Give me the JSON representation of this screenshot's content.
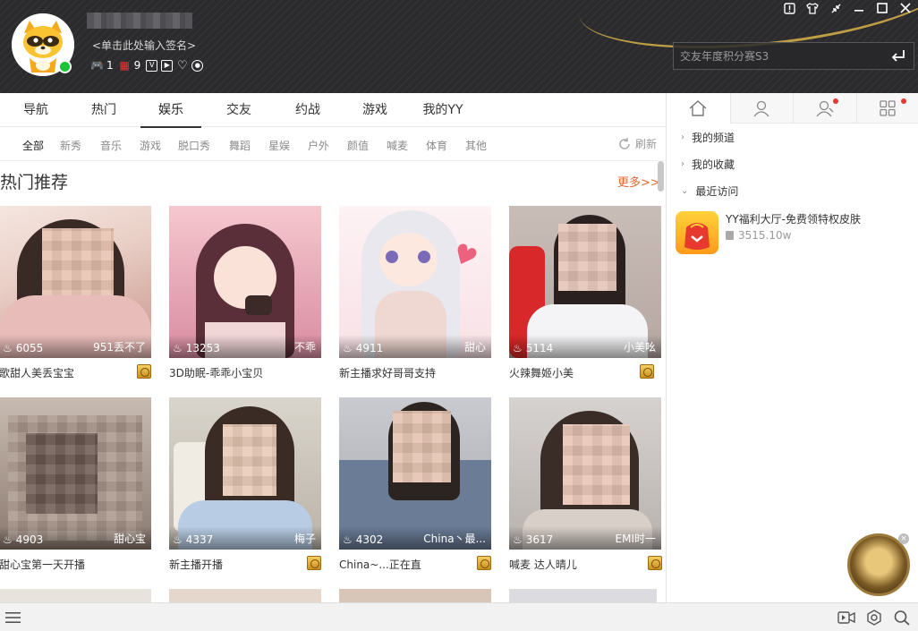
{
  "header": {
    "signature": "<单击此处输入签名>",
    "badges": [
      {
        "icon": "gamepad-icon",
        "count": "1"
      },
      {
        "icon": "gift-icon",
        "count": "9"
      },
      {
        "icon": "v-badge-icon",
        "count": ""
      },
      {
        "icon": "play-icon",
        "count": ""
      },
      {
        "icon": "heart-icon",
        "count": ""
      },
      {
        "icon": "eye-icon",
        "count": ""
      }
    ],
    "search_placeholder": "交友年度积分赛S3"
  },
  "tabs": [
    "导航",
    "热门",
    "娱乐",
    "交友",
    "约战",
    "游戏",
    "我的YY"
  ],
  "active_tab": "娱乐",
  "subcategories": [
    "全部",
    "新秀",
    "音乐",
    "游戏",
    "脱口秀",
    "舞蹈",
    "星娱",
    "户外",
    "颜值",
    "喊麦",
    "体育",
    "其他"
  ],
  "refresh_label": "刷新",
  "section_title": "热门推荐",
  "more_label": "更多>>",
  "cards": [
    {
      "title": "歌甜人美丢宝宝",
      "viewers": "6055",
      "anchor": "951丢不了"
    },
    {
      "title": "3D助眠-乖乖小宝贝",
      "viewers": "13253",
      "anchor": "不乖"
    },
    {
      "title": "新主播求好哥哥支持",
      "viewers": "4911",
      "anchor": "甜心"
    },
    {
      "title": "火辣舞姬小美",
      "viewers": "5114",
      "anchor": "小美吆"
    },
    {
      "title": "甜心宝第一天开播",
      "viewers": "4903",
      "anchor": "甜心宝"
    },
    {
      "title": "新主播开播",
      "viewers": "4337",
      "anchor": "梅子"
    },
    {
      "title": "China~...正在直",
      "viewers": "4302",
      "anchor": "China丶最..."
    },
    {
      "title": "喊麦 达人晴儿",
      "viewers": "3617",
      "anchor": "EMI时一"
    }
  ],
  "right_panel": {
    "tree": [
      "我的频道",
      "我的收藏",
      "最近访问"
    ],
    "recent": {
      "title": "YY福利大厅-免费领特权皮肤",
      "count": "3515.10w"
    }
  },
  "colors": {
    "accent": "#e4662c",
    "header_bg": "#2b2b2d",
    "online": "#1bc53a"
  }
}
